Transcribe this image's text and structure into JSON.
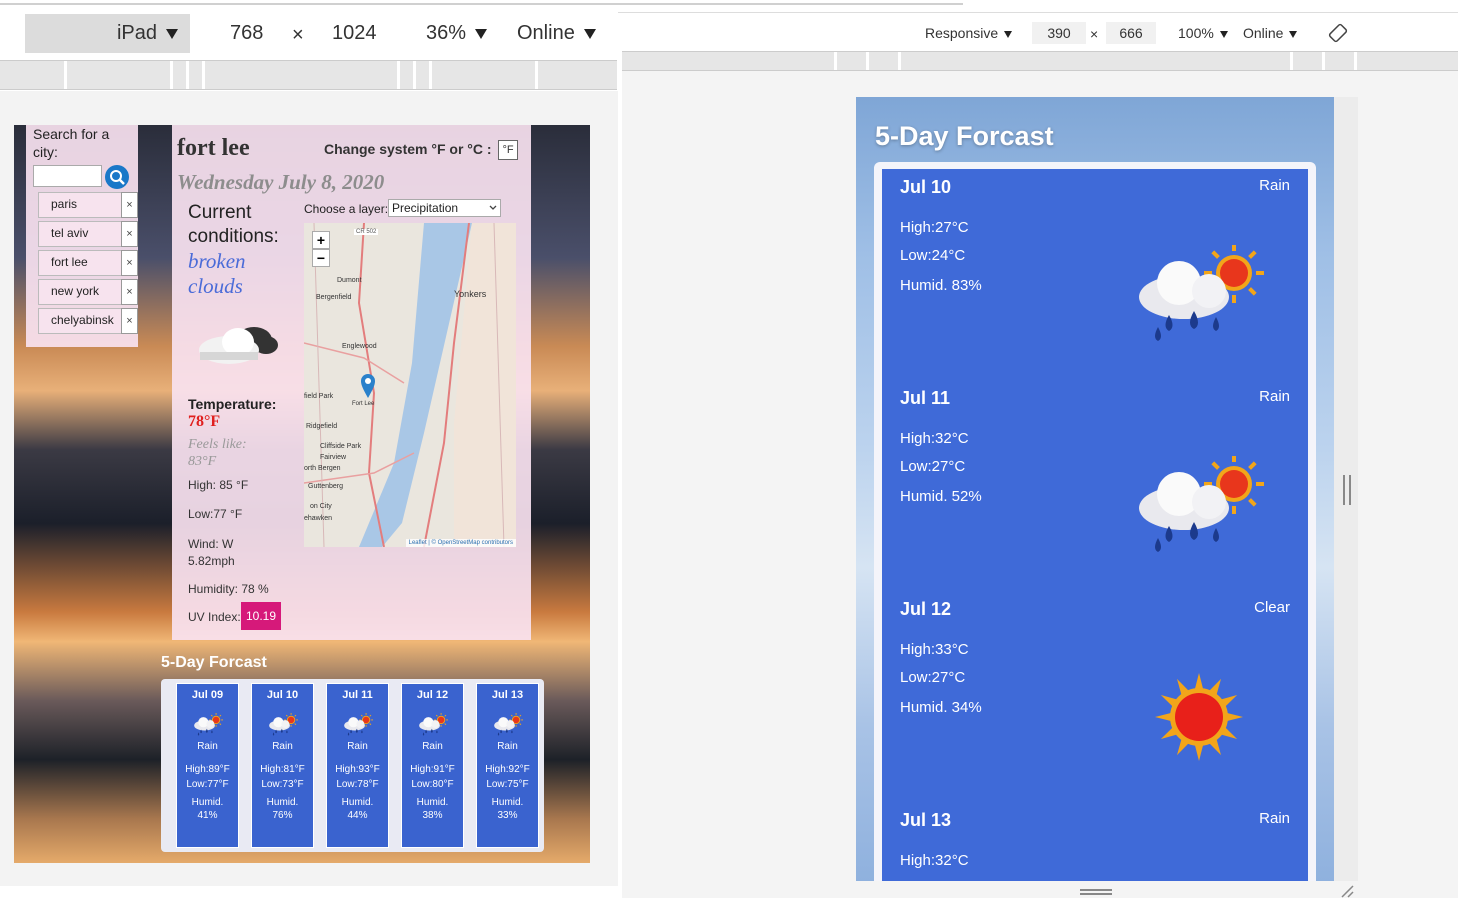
{
  "left_toolbar": {
    "device": "iPad",
    "width": "768",
    "times": "×",
    "height": "1024",
    "zoom": "36%",
    "network": "Online"
  },
  "right_toolbar": {
    "device": "Responsive",
    "width": "390",
    "times": "×",
    "height": "666",
    "zoom": "100%",
    "network": "Online"
  },
  "app": {
    "search_label": "Search for a city:",
    "search_value": "",
    "cities": [
      "paris",
      "tel aviv",
      "fort lee",
      "new york",
      "chelyabinsk"
    ],
    "remove_glyph": "×",
    "city_name": "fort lee",
    "unit_label": "Change system °F or °C :",
    "unit_button": "°F",
    "date": "Wednesday July 8, 2020",
    "current_label": "Current conditions:",
    "condition": "broken clouds",
    "temperature_label": "Temperature:",
    "temperature": "78°F",
    "feels_like": "Feels like: 83°F",
    "high": "High: 85 °F",
    "low": "Low:77 °F",
    "wind": "Wind: W 5.82mph",
    "humidity": "Humidity: 78 %",
    "uv_label": "UV Index:",
    "uv_value": "10.19",
    "layer_label": "Choose a layer:",
    "layer_value": "Precipitation",
    "map": {
      "zoom_in": "+",
      "zoom_out": "−",
      "road": "CR 502",
      "places": [
        "Dumont",
        "Bergenfield",
        "Yonkers",
        "Englewood",
        "field Park",
        "Fort Lee",
        "Ridgefield",
        "Cliffside Park",
        "Fairview",
        "orth Bergen",
        "Guttenberg",
        "on City",
        "ehawken"
      ],
      "attribution": "Leaflet | © OpenStreetMap contributors"
    },
    "forecast_title": "5-Day Forcast",
    "forecast_small": [
      {
        "date": "Jul 09",
        "status": "Rain",
        "high": "High:89°F",
        "low": "Low:77°F",
        "humid": "Humid. 41%"
      },
      {
        "date": "Jul 10",
        "status": "Rain",
        "high": "High:81°F",
        "low": "Low:73°F",
        "humid": "Humid. 76%"
      },
      {
        "date": "Jul 11",
        "status": "Rain",
        "high": "High:93°F",
        "low": "Low:78°F",
        "humid": "Humid. 44%"
      },
      {
        "date": "Jul 12",
        "status": "Rain",
        "high": "High:91°F",
        "low": "Low:80°F",
        "humid": "Humid. 38%"
      },
      {
        "date": "Jul 13",
        "status": "Rain",
        "high": "High:92°F",
        "low": "Low:75°F",
        "humid": "Humid. 33%"
      }
    ]
  },
  "mobile": {
    "forecast_title": "5-Day Forcast",
    "cards": [
      {
        "date": "Jul 10",
        "status": "Rain",
        "high": "High:27°C",
        "low": "Low:24°C",
        "humid": "Humid. 83%",
        "icon": "rain-sun-icon"
      },
      {
        "date": "Jul 11",
        "status": "Rain",
        "high": "High:32°C",
        "low": "Low:27°C",
        "humid": "Humid. 52%",
        "icon": "rain-sun-icon"
      },
      {
        "date": "Jul 12",
        "status": "Clear",
        "high": "High:33°C",
        "low": "Low:27°C",
        "humid": "Humid. 34%",
        "icon": "sun-icon"
      },
      {
        "date": "Jul 13",
        "status": "Rain",
        "high": "High:32°C",
        "low": "",
        "humid": "",
        "icon": "rain-sun-icon"
      }
    ]
  },
  "colors": {
    "card_blue": "#3f6ad8",
    "uv_badge": "#d6197a",
    "temp_red": "#e0201f",
    "condition_blue": "#4a6bd8"
  }
}
